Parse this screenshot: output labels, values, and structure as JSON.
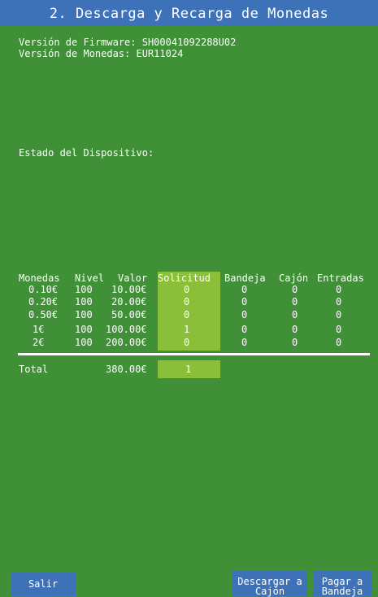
{
  "header": {
    "title": "2. Descarga y Recarga de Monedas"
  },
  "info": {
    "firmware": "Versión de Firmware: SH00041092288U02",
    "coins_version": "Versión de Monedas: EUR11024",
    "device_status": "Estado del Dispositivo:"
  },
  "table": {
    "columns": [
      "Monedas",
      "Nivel",
      "Valor",
      "Solicitud",
      "Bandeja",
      "Cajón",
      "Entradas"
    ],
    "rows": [
      [
        "0.10€",
        "100",
        "10.00€",
        "0",
        "0",
        "0",
        "0"
      ],
      [
        "0.20€",
        "100",
        "20.00€",
        "0",
        "0",
        "0",
        "0"
      ],
      [
        "0.50€",
        "100",
        "50.00€",
        "0",
        "0",
        "0",
        "0"
      ],
      [
        "1€",
        "100",
        "100.00€",
        "1",
        "0",
        "0",
        "0"
      ],
      [
        "2€",
        "100",
        "200.00€",
        "0",
        "0",
        "0",
        "0"
      ]
    ],
    "total": {
      "label": "Total",
      "valor": "380.00€",
      "solicitud": "1"
    }
  },
  "buttons": {
    "salir": "Salir",
    "descargar": "Descargar a\nCajón",
    "pagar": "Pagar a\nBandeja"
  },
  "colors": {
    "background": "#409037",
    "title_bar": "#3e72b8",
    "highlight": "#8bbf3a",
    "button": "#3e72b8"
  }
}
